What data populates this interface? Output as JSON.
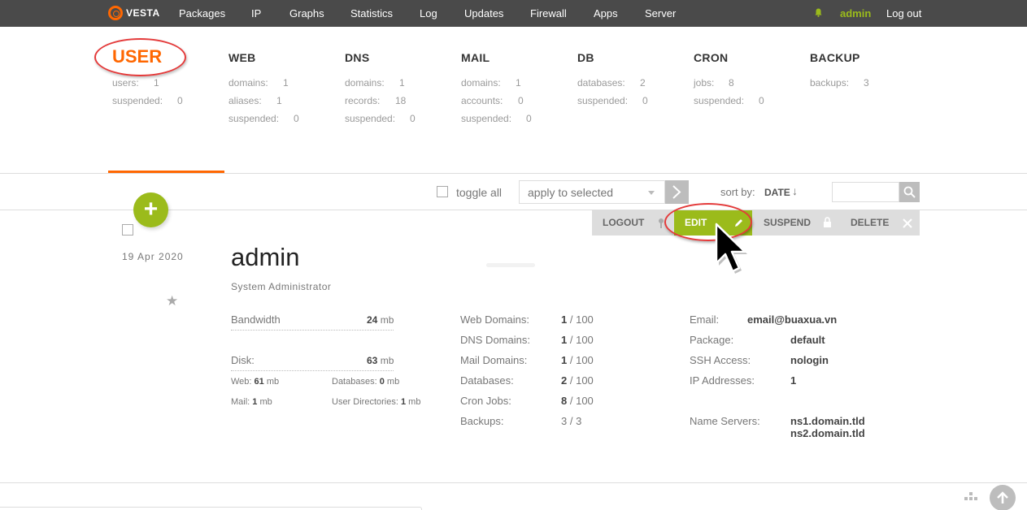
{
  "nav": {
    "logo_text": "VESTA",
    "items": [
      "Packages",
      "IP",
      "Graphs",
      "Statistics",
      "Log",
      "Updates",
      "Firewall",
      "Apps",
      "Server"
    ],
    "user": "admin",
    "logout": "Log out"
  },
  "summary": {
    "user": {
      "title": "USER",
      "lines": [
        {
          "label": "users:",
          "value": "1"
        },
        {
          "label": "suspended:",
          "value": "0"
        }
      ]
    },
    "web": {
      "title": "WEB",
      "lines": [
        {
          "label": "domains:",
          "value": "1"
        },
        {
          "label": "aliases:",
          "value": "1"
        },
        {
          "label": "suspended:",
          "value": "0"
        }
      ]
    },
    "dns": {
      "title": "DNS",
      "lines": [
        {
          "label": "domains:",
          "value": "1"
        },
        {
          "label": "records:",
          "value": "18"
        },
        {
          "label": "suspended:",
          "value": "0"
        }
      ]
    },
    "mail": {
      "title": "MAIL",
      "lines": [
        {
          "label": "domains:",
          "value": "1"
        },
        {
          "label": "accounts:",
          "value": "0"
        },
        {
          "label": "suspended:",
          "value": "0"
        }
      ]
    },
    "db": {
      "title": "DB",
      "lines": [
        {
          "label": "databases:",
          "value": "2"
        },
        {
          "label": "suspended:",
          "value": "0"
        }
      ]
    },
    "cron": {
      "title": "CRON",
      "lines": [
        {
          "label": "jobs:",
          "value": "8"
        },
        {
          "label": "suspended:",
          "value": "0"
        }
      ]
    },
    "backup": {
      "title": "BACKUP",
      "lines": [
        {
          "label": "backups:",
          "value": "3"
        }
      ]
    }
  },
  "toolbar": {
    "toggle_all": "toggle all",
    "apply_placeholder": "apply to selected",
    "sort_by": "sort by:",
    "sort_value": "DATE",
    "sort_arrow": "↓"
  },
  "actions": {
    "logout": "LOGOUT",
    "edit": "EDIT",
    "suspend": "SUSPEND",
    "delete": "DELETE"
  },
  "row": {
    "date": "19  Apr  2020",
    "username": "admin",
    "fullname": "System Administrator",
    "bandwidth": {
      "label": "Bandwidth",
      "value": "24",
      "unit": "mb"
    },
    "disk": {
      "label": "Disk:",
      "value": "63",
      "unit": "mb"
    },
    "disk_web": {
      "label": "Web:",
      "value": "61",
      "unit": "mb"
    },
    "disk_db": {
      "label": "Databases:",
      "value": "0",
      "unit": "mb"
    },
    "disk_mail": {
      "label": "Mail:",
      "value": "1",
      "unit": "mb"
    },
    "disk_udir": {
      "label": "User Directories:",
      "value": "1",
      "unit": "mb"
    },
    "limits": [
      {
        "label": "Web Domains:",
        "used": "1",
        "max": "/ 100"
      },
      {
        "label": "DNS Domains:",
        "used": "1",
        "max": "/ 100"
      },
      {
        "label": "Mail Domains:",
        "used": "1",
        "max": "/ 100"
      },
      {
        "label": "Databases:",
        "used": "2",
        "max": "/ 100"
      },
      {
        "label": "Cron Jobs:",
        "used": "8",
        "max": "/ 100"
      },
      {
        "label": "Backups:",
        "used": "3",
        "max": "/ 3"
      }
    ],
    "info": {
      "email_label": "Email:",
      "email": "email@buaxua.vn",
      "package_label": "Package:",
      "package": "default",
      "ssh_label": "SSH Access:",
      "ssh": "nologin",
      "ip_label": "IP Addresses:",
      "ip": "1",
      "ns_label": "Name Servers:",
      "ns1": "ns1.domain.tld",
      "ns2": "ns2.domain.tld"
    }
  },
  "colors": {
    "accent": "#ff6701",
    "green": "#9bbb1b",
    "highlight_red": "#e43a3a",
    "nav_bg": "#4a4a4a"
  }
}
